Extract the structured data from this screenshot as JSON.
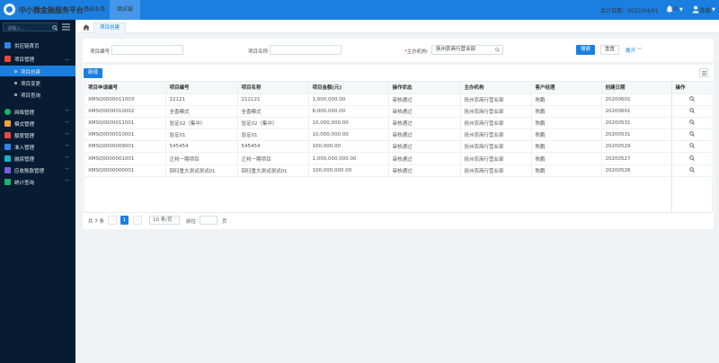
{
  "header": {
    "brand": "中小微金融服务平台",
    "nav": [
      "基础业务",
      "供应链"
    ],
    "active_nav": 1,
    "account_date_label": "会计日期：2022/04/01",
    "notification_count": "0",
    "user_name": "陈鹏",
    "colors": {
      "bar": "#1a7fe0",
      "active_nav": "#4697ea"
    }
  },
  "sidebar": {
    "search_placeholder": "请输入...",
    "items": [
      {
        "label": "供应链首页",
        "icon": "monitor-icon",
        "icon_color": "#2f84e6",
        "expanded": false,
        "has_children": false
      },
      {
        "label": "项目管理",
        "icon": "project-icon",
        "icon_color": "#e9483f",
        "expanded": true,
        "has_children": true,
        "children": [
          {
            "label": "项目创建",
            "active": true
          },
          {
            "label": "项目变更",
            "active": false
          },
          {
            "label": "项目查询",
            "active": false
          }
        ]
      },
      {
        "label": "网络管理",
        "icon": "network-icon",
        "icon_color": "#18b566",
        "expanded": false,
        "has_children": true
      },
      {
        "label": "模式管理",
        "icon": "mode-icon",
        "icon_color": "#f0a23b",
        "expanded": false,
        "has_children": true
      },
      {
        "label": "额度管理",
        "icon": "quota-icon",
        "icon_color": "#e9483f",
        "expanded": false,
        "has_children": true
      },
      {
        "label": "准入管理",
        "icon": "access-icon",
        "icon_color": "#2f84e6",
        "expanded": false,
        "has_children": true
      },
      {
        "label": "融资管理",
        "icon": "finance-icon",
        "icon_color": "#1ab1c4",
        "expanded": false,
        "has_children": true
      },
      {
        "label": "应收账款管理",
        "icon": "receivable-icon",
        "icon_color": "#7b5ce0",
        "expanded": false,
        "has_children": true
      },
      {
        "label": "统计查询",
        "icon": "stats-icon",
        "icon_color": "#18b566",
        "expanded": false,
        "has_children": true
      }
    ]
  },
  "tabs": [
    {
      "label": "项目创建",
      "active": true
    }
  ],
  "search": {
    "fields": [
      {
        "label": "项目编号",
        "value": "",
        "required": false
      },
      {
        "label": "项目名称",
        "value": "",
        "required": false
      },
      {
        "label": "主办机构:",
        "value": "抚州农商行营业部",
        "required": true
      }
    ],
    "search_button": "搜索",
    "reset_button": "重置",
    "expand_link": "展开"
  },
  "toolbar": {
    "add_button": "新增"
  },
  "table": {
    "columns": [
      "项目申请编号",
      "项目编号",
      "项目名称",
      "项目金额(元)",
      "操作状态",
      "主办机构",
      "客户经理",
      "创建日期",
      "操作"
    ],
    "rows": [
      [
        "XMSQ0000011003",
        "22121",
        "212121",
        "1,000,000.00",
        "审核通过",
        "抚州农商行营业部",
        "陈鹏",
        "20200601"
      ],
      [
        "XMSQ0000010002",
        "全香模式",
        "全香模式",
        "8,000,000.00",
        "审核通过",
        "抚州农商行营业部",
        "陈鹏",
        "20200601"
      ],
      [
        "XMSQ0000011001",
        "验证02（集中）",
        "验证02（集中）",
        "10,000,000.00",
        "审核通过",
        "抚州农商行营业部",
        "陈鹏",
        "20200531"
      ],
      [
        "XMSQ0000010001",
        "验证01",
        "验证01",
        "10,000,000.00",
        "审核通过",
        "抚州农商行营业部",
        "陈鹏",
        "20200531"
      ],
      [
        "XMSQ0000009001",
        "545454",
        "545454",
        "100,000.00",
        "审核通过",
        "抚州农商行营业部",
        "陈鹏",
        "20200529"
      ],
      [
        "XMSQ0000001001",
        "正邦一期项目",
        "正邦一期项目",
        "1,000,000,000.00",
        "审核通过",
        "抚州农商行营业部",
        "陈鹏",
        "20200527"
      ],
      [
        "XMSQ0000000001",
        "回归重大测试测试01",
        "回归重大测试测试01",
        "100,000,000.00",
        "审核通过",
        "抚州农商行营业部",
        "陈鹏",
        "20200526"
      ]
    ]
  },
  "pagination": {
    "total_text": "共 7 条",
    "current_page": "1",
    "page_size": "10 条/页",
    "jump_prefix": "前往",
    "jump_suffix": "页"
  }
}
